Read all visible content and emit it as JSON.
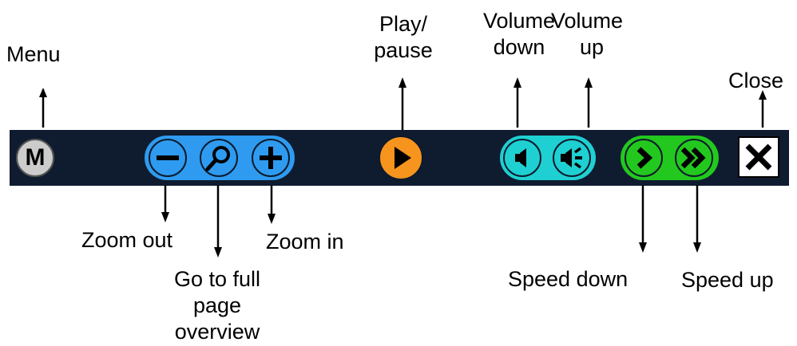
{
  "labels": {
    "menu": "Menu",
    "zoom_out": "Zoom out",
    "full_page": [
      "Go to full",
      "page",
      "overview"
    ],
    "zoom_in": "Zoom in",
    "play_pause": [
      "Play/",
      "pause"
    ],
    "volume_down": [
      "Volume",
      "down"
    ],
    "volume_up": [
      "Volume",
      "up"
    ],
    "close": "Close",
    "speed_down": "Speed down",
    "speed_up": "Speed up"
  },
  "toolbar": {
    "menu_glyph": "M"
  },
  "colors": {
    "toolbar_bg": "#0f1c30",
    "zoom_group": "#2e9bf0",
    "play": "#f7941d",
    "volume_group": "#1fd0d2",
    "speed_group": "#23c81e",
    "menu_button": "#cccccc",
    "close_button": "#ffffff"
  },
  "icons": {
    "menu": "menu-icon",
    "zoom_out": "minus-icon",
    "full_page": "magnifier-icon",
    "zoom_in": "plus-icon",
    "play": "play-icon",
    "volume_down": "speaker-quiet-icon",
    "volume_up": "speaker-loud-icon",
    "speed_down": "chevron-right-icon",
    "speed_up": "double-chevron-right-icon",
    "close": "close-x-icon"
  }
}
